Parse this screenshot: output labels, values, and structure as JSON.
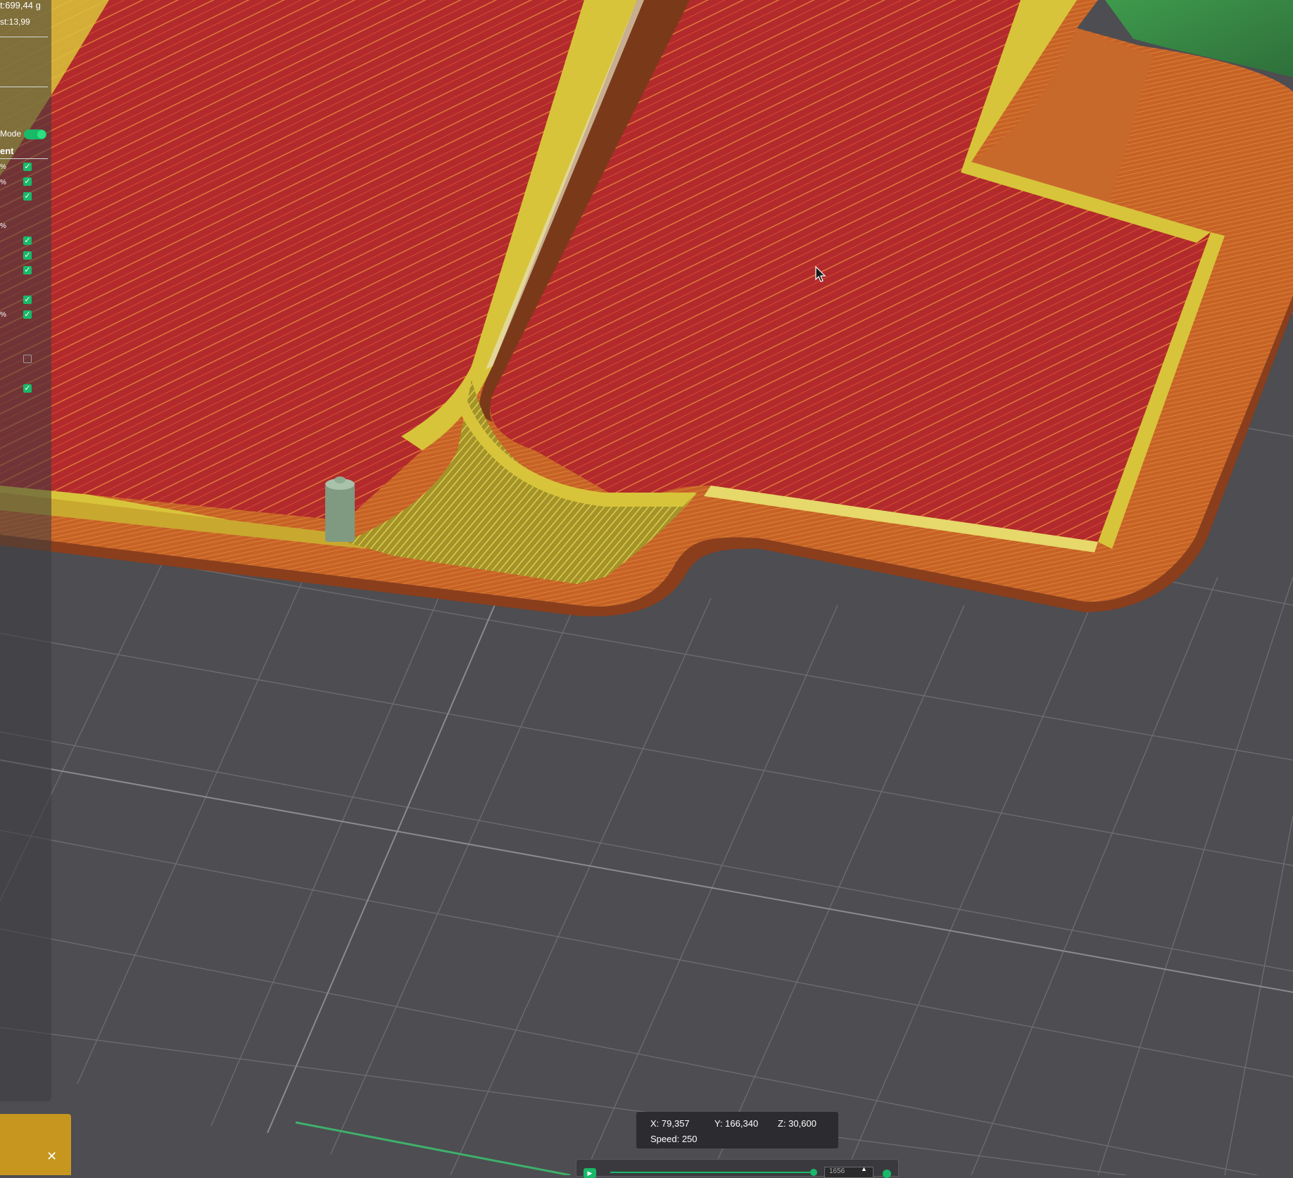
{
  "app": {
    "view": "G-code preview"
  },
  "left_panel": {
    "weight_line": "t:699,44 g",
    "cost_line": "st:13,99",
    "mode_label": "Mode",
    "section_label": "ent",
    "percent_labels": [
      "%",
      "%",
      "%",
      "%"
    ],
    "checkboxes": [
      {
        "checked": true
      },
      {
        "checked": true
      },
      {
        "checked": true
      },
      {
        "checked": true
      },
      {
        "checked": true
      },
      {
        "checked": true
      },
      {
        "checked": true
      },
      {
        "checked": true
      },
      {
        "checked": false
      },
      {
        "checked": true
      }
    ]
  },
  "coordinates": {
    "x": "X: 79,357",
    "y": "Y: 166,340",
    "z": "Z: 30,600",
    "speed": "Speed: 250"
  },
  "notification": {
    "close_icon": "close-icon"
  },
  "slider": {
    "layer_value": "1656",
    "progress": 0.97
  },
  "colors": {
    "infill": "#b5262a",
    "perimeter": "#d8c43a",
    "outer_wall": "#c8622a",
    "support": "#b8a030",
    "bed": "#4d4d52",
    "accent": "#19b96a"
  }
}
